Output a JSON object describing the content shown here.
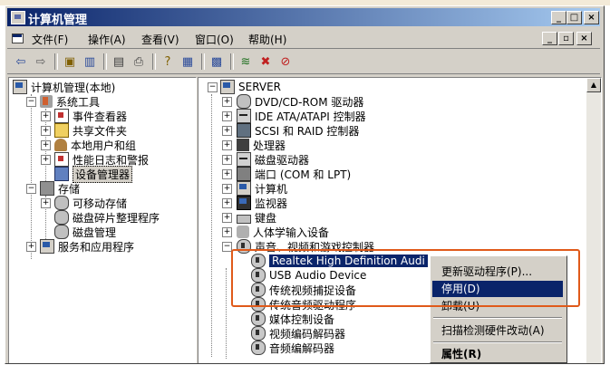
{
  "window": {
    "title": "计算机管理"
  },
  "menu": [
    "文件(F)",
    "操作(A)",
    "查看(V)",
    "窗口(O)",
    "帮助(H)"
  ],
  "left_tree": [
    {
      "label": "计算机管理(本地)"
    },
    {
      "label": "系统工具"
    },
    {
      "label": "事件查看器"
    },
    {
      "label": "共享文件夹"
    },
    {
      "label": "本地用户和组"
    },
    {
      "label": "性能日志和警报"
    },
    {
      "label": "设备管理器"
    },
    {
      "label": "存储"
    },
    {
      "label": "可移动存储"
    },
    {
      "label": "磁盘碎片整理程序"
    },
    {
      "label": "磁盘管理"
    },
    {
      "label": "服务和应用程序"
    }
  ],
  "right_tree": [
    {
      "label": "SERVER"
    },
    {
      "label": "DVD/CD-ROM 驱动器"
    },
    {
      "label": "IDE ATA/ATAPI 控制器"
    },
    {
      "label": "SCSI 和 RAID 控制器"
    },
    {
      "label": "处理器"
    },
    {
      "label": "磁盘驱动器"
    },
    {
      "label": "端口 (COM 和 LPT)"
    },
    {
      "label": "计算机"
    },
    {
      "label": "监视器"
    },
    {
      "label": "键盘"
    },
    {
      "label": "人体学输入设备"
    },
    {
      "label": "声音、视频和游戏控制器"
    },
    {
      "label": "Realtek High Definition Audi"
    },
    {
      "label": "USB Audio Device"
    },
    {
      "label": "传统视频捕捉设备"
    },
    {
      "label": "传统音频驱动程序"
    },
    {
      "label": "媒体控制设备"
    },
    {
      "label": "视频编码解码器"
    },
    {
      "label": "音频编解码器"
    }
  ],
  "context_menu": [
    "更新驱动程序(P)...",
    "停用(D)",
    "卸载(U)",
    "扫描检测硬件改动(A)",
    "属性(R)"
  ],
  "colors": {
    "titlebar": "#0a246a",
    "selection": "#0a246a",
    "highlight_box": "#e05a1a"
  }
}
